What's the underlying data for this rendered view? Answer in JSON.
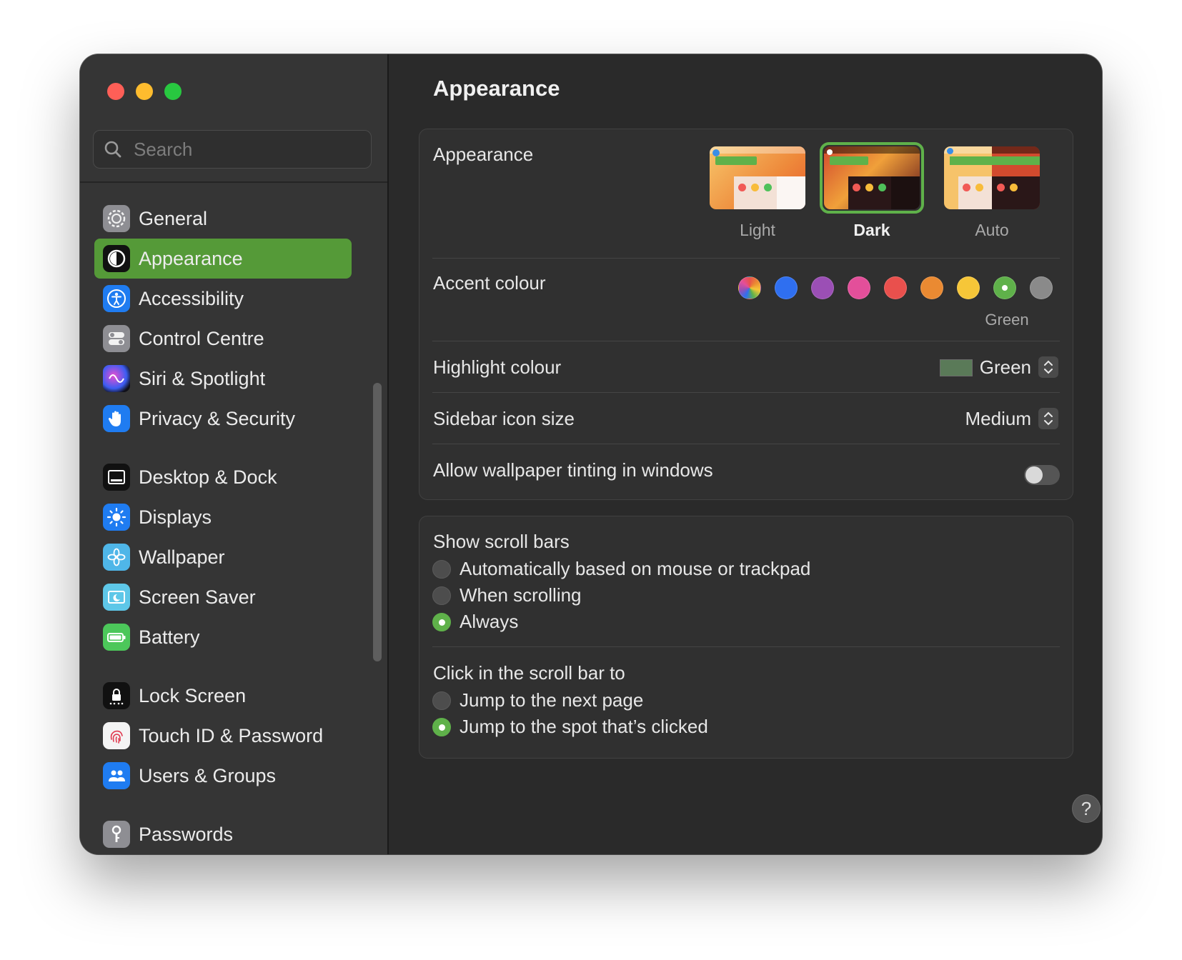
{
  "window": {
    "title": "Appearance"
  },
  "search": {
    "placeholder": "Search"
  },
  "sidebar": {
    "items": [
      {
        "label": "General",
        "icon": "gear-icon"
      },
      {
        "label": "Appearance",
        "icon": "appearance-icon",
        "selected": true
      },
      {
        "label": "Accessibility",
        "icon": "accessibility-icon"
      },
      {
        "label": "Control Centre",
        "icon": "control-centre-icon"
      },
      {
        "label": "Siri & Spotlight",
        "icon": "siri-icon"
      },
      {
        "label": "Privacy & Security",
        "icon": "hand-icon"
      },
      {
        "label": "Desktop & Dock",
        "icon": "dock-icon"
      },
      {
        "label": "Displays",
        "icon": "sun-icon"
      },
      {
        "label": "Wallpaper",
        "icon": "flower-icon"
      },
      {
        "label": "Screen Saver",
        "icon": "screen-saver-icon"
      },
      {
        "label": "Battery",
        "icon": "battery-icon"
      },
      {
        "label": "Lock Screen",
        "icon": "lock-icon"
      },
      {
        "label": "Touch ID & Password",
        "icon": "fingerprint-icon"
      },
      {
        "label": "Users & Groups",
        "icon": "users-icon"
      },
      {
        "label": "Passwords",
        "icon": "key-icon"
      }
    ]
  },
  "main": {
    "title": "Appearance",
    "appearance": {
      "label": "Appearance",
      "options": [
        {
          "label": "Light",
          "selected": false
        },
        {
          "label": "Dark",
          "selected": true
        },
        {
          "label": "Auto",
          "selected": false
        }
      ]
    },
    "accent": {
      "label": "Accent colour",
      "selected_name": "Green",
      "colors": [
        "multicolor",
        "#2f6ff0",
        "#9b4fb5",
        "#e34f9a",
        "#e9504d",
        "#ea8a32",
        "#f6c638",
        "#5fb14a",
        "#8a8a8a"
      ]
    },
    "highlight": {
      "label": "Highlight colour",
      "value": "Green",
      "swatch": "#5a7a58"
    },
    "sidebar_icon_size": {
      "label": "Sidebar icon size",
      "value": "Medium"
    },
    "wallpaper_tinting": {
      "label": "Allow wallpaper tinting in windows",
      "enabled": false
    },
    "scroll_bars": {
      "label": "Show scroll bars",
      "options": [
        {
          "label": "Automatically based on mouse or trackpad",
          "selected": false
        },
        {
          "label": "When scrolling",
          "selected": false
        },
        {
          "label": "Always",
          "selected": true
        }
      ]
    },
    "click_scroll": {
      "label": "Click in the scroll bar to",
      "options": [
        {
          "label": "Jump to the next page",
          "selected": false
        },
        {
          "label": "Jump to the spot that’s clicked",
          "selected": true
        }
      ]
    },
    "help": {
      "label": "?"
    }
  },
  "colors": {
    "accent": "#559a38",
    "background": "#2a2a2a",
    "sidebar": "#353535"
  }
}
